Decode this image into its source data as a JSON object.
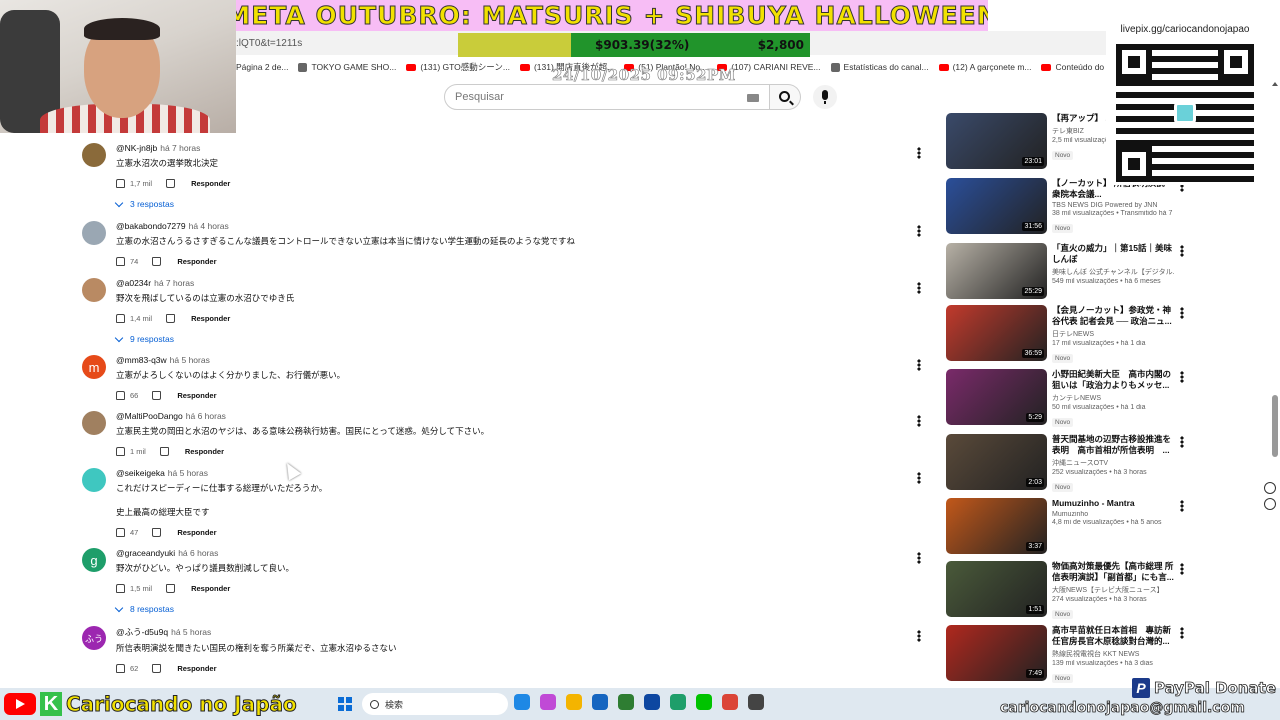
{
  "overlay": {
    "banner": "META OUTUBRO: MATSURIS +  SHIBUYA HALLOWEEN",
    "progress_current": "$903.39(32%)",
    "progress_goal": "$2,800",
    "progress_fraction": 0.32,
    "timestamp": "24/10/2025 09:52PM",
    "qr_label": "livepix.gg/cariocandonojapao",
    "paypal": "PayPal Donate",
    "email": "cariocandonojapao@gmail.com",
    "channel_name": "Cariocando no Japão",
    "channel_k": "K"
  },
  "browser": {
    "address": ":lQT0&t=1211s",
    "bookmarks": [
      {
        "label": "Página 2 de...",
        "icon": "none"
      },
      {
        "label": "TOKYO GAME SHO...",
        "icon": "tgs"
      },
      {
        "label": "(131) GTO感動シーン...",
        "icon": "youtube"
      },
      {
        "label": "(131) 開店直後が超...",
        "icon": "youtube"
      },
      {
        "label": "(51) Plantão! No...",
        "icon": "youtube"
      },
      {
        "label": "(107) CARIANI REVE...",
        "icon": "youtube"
      },
      {
        "label": "Estatísticas do canal...",
        "icon": "generic"
      },
      {
        "label": "(12) A garçonete m...",
        "icon": "youtube"
      },
      {
        "label": "Conteúdo do canal...",
        "icon": "youtube"
      }
    ]
  },
  "search": {
    "placeholder": "Pesquisar"
  },
  "comments": [
    {
      "author": "@NK-jn8jb",
      "time": "há 7 horas",
      "text": "立憲水沼次の選挙敗北決定",
      "likes": "1,7 mil",
      "reply": "Responder",
      "replies": "3 respostas",
      "avatar_color": "#8a6a3a",
      "initial": ""
    },
    {
      "author": "@bakabondo7279",
      "time": "há 4 horas",
      "text": "立憲の水沼さんうるさすぎるこんな議員をコントロールできない立憲は本当に情けない学生運動の延長のような党ですね",
      "likes": "74",
      "reply": "Responder",
      "replies": "",
      "avatar_color": "#9aa7b3",
      "initial": ""
    },
    {
      "author": "@a0234r",
      "time": "há 7 horas",
      "text": "野次を飛ばしているのは立憲の水沼ひでゆき氏",
      "likes": "1,4 mil",
      "reply": "Responder",
      "replies": "9 respostas",
      "avatar_color": "#b98a63",
      "initial": ""
    },
    {
      "author": "@mm83-q3w",
      "time": "há 5 horas",
      "text": "立憲がよろしくないのはよく分かりました、お行儀が悪い。",
      "likes": "66",
      "reply": "Responder",
      "replies": "",
      "avatar_color": "#e64a19",
      "initial": "m"
    },
    {
      "author": "@MaltiPooDango",
      "time": "há 6 horas",
      "text": "立憲民主党の岡田と水沼のヤジは、ある意味公務執行妨害。国民にとって迷惑。処分して下さい。",
      "likes": "1 mil",
      "reply": "Responder",
      "replies": "",
      "avatar_color": "#a08060",
      "initial": ""
    },
    {
      "author": "@seikeigeka",
      "time": "há 5 horas",
      "text": "これだけスピーディーに仕事する総理がいただろうか。",
      "text2": "史上最高の総理大臣です",
      "likes": "47",
      "reply": "Responder",
      "replies": "",
      "avatar_color": "#3fc7c0",
      "initial": ""
    },
    {
      "author": "@graceandyuki",
      "time": "há 6 horas",
      "text": "野次がひどい。やっぱり議員数削減して良い。",
      "likes": "1,5 mil",
      "reply": "Responder",
      "replies": "8 respostas",
      "avatar_color": "#1e9e6a",
      "initial": "g"
    },
    {
      "author": "@ふう-d5u9q",
      "time": "há 5 horas",
      "text": "所信表明演説を聞きたい国民の権利を奪う所業だぞ、立憲水沼ゆるさない",
      "likes": "62",
      "reply": "Responder",
      "replies": "",
      "avatar_color": "#9c27b0",
      "initial": "ふう"
    }
  ],
  "videos": [
    {
      "title": "【再アップ】 ...い原発「高温...",
      "channel": "テレ東BIZ",
      "meta": "2,5 mil visualizações",
      "badge": "Novo",
      "duration": "23:01",
      "color": "#3a4a6a"
    },
    {
      "title": "【ノーカット】 所信表明演説　衆院本会議...",
      "channel": "TBS NEWS DIG Powered by JNN",
      "meta": "38 mil visualizações • Transmitido há 7 ...",
      "badge": "Novo",
      "duration": "31:56",
      "color": "#2b4f9a"
    },
    {
      "title": "「直火の威力」｜第15話｜美味しんぼ",
      "channel": "美味しんぼ 公式チャンネル【デジタル...",
      "meta": "549 mil visualizações • há 6 meses",
      "badge": "",
      "duration": "25:29",
      "color": "#b7b1a6"
    },
    {
      "title": "【会見ノーカット】参政党・神谷代表 記者会見 ── 政治ニュ...",
      "channel": "日テレNEWS",
      "meta": "17 mil visualizações • há 1 dia",
      "badge": "Novo",
      "duration": "36:59",
      "color": "#c23a2c"
    },
    {
      "title": "小野田紀美新大臣　高市内閣の狙いは「政治力よりもメッセ...",
      "channel": "カンテレNEWS",
      "meta": "50 mil visualizações • há 1 dia",
      "badge": "Novo",
      "duration": "5:29",
      "color": "#7a2a6a"
    },
    {
      "title": "普天間基地の辺野古移設推進を表明　高市首相が所信表明　...",
      "channel": "沖縄ニュースOTV",
      "meta": "252 visualizações • há 3 horas",
      "badge": "Novo",
      "duration": "2:03",
      "color": "#5a4a3a"
    },
    {
      "title": "Mumuzinho - Mantra",
      "channel": "Mumuzinho",
      "meta": "4,8 mi de visualizações • há 5 anos",
      "badge": "",
      "duration": "3:37",
      "color": "#c2581a"
    },
    {
      "title": "物価高対策最優先【高市総理 所信表明演説】「副首都」にも言...",
      "channel": "大阪NEWS【テレビ大阪ニュース】",
      "meta": "274 visualizações • há 3 horas",
      "badge": "Novo",
      "duration": "1:51",
      "color": "#4a5a3a"
    },
    {
      "title": "高市早苗就任日本首相　專訪新任官房長官木原稔談對台灣的...",
      "channel": "熱線民視電視台 KKT NEWS",
      "meta": "139 mil visualizações • há 3 dias",
      "badge": "Novo",
      "duration": "7:49",
      "color": "#b0281e"
    }
  ],
  "taskbar": {
    "search_label": "検索"
  }
}
